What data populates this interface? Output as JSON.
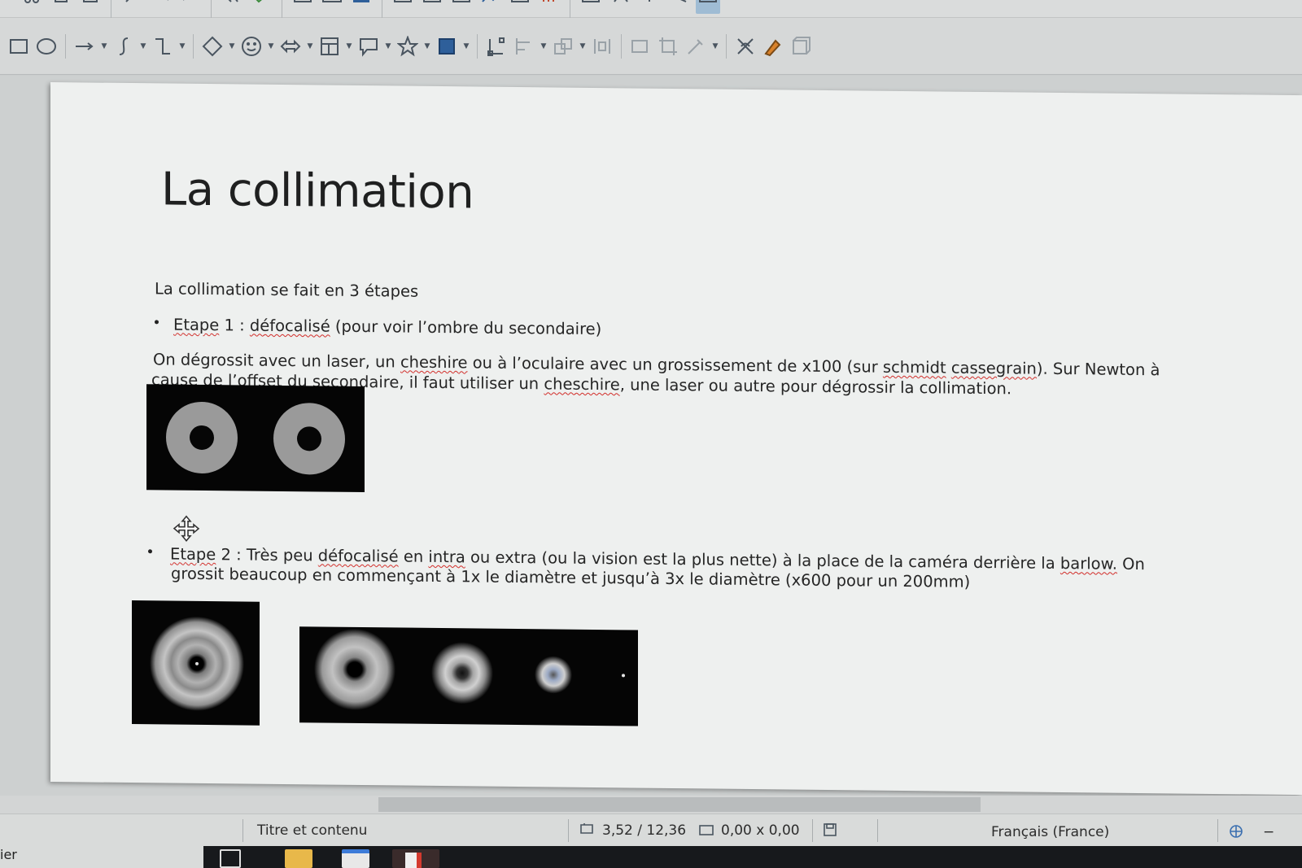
{
  "slide": {
    "title": "La collimation",
    "intro": "La collimation se fait en 3 étapes",
    "step1": {
      "label": "Etape",
      "num": " 1 : ",
      "word": "défocalisé",
      "rest": " (pour voir l’ombre du secondaire)"
    },
    "para1": {
      "a": "On dégrossit avec un laser, un ",
      "b": "cheshire",
      "c": " ou à l’oculaire avec un grossissement de x100 (sur ",
      "d": "schmidt",
      "e": " ",
      "f": "cassegrain",
      "g": "). Sur Newton à",
      "h": "cause de l’offset du secondaire, il faut utiliser un ",
      "i": "cheschire",
      "j": ", une laser ou autre pour dégrossir la collimation."
    },
    "step2": {
      "label": "Etape",
      "num": " 2 : Très peu ",
      "word": "défocalisé",
      "mid1": " en ",
      "intra": "intra",
      "mid2": " ou extra (ou la vision est la plus nette) à la place de la caméra derrière la ",
      "barlow": "barlow.",
      "end": " On",
      "line2": "grossit beaucoup en commençant à 1x le diamètre et jusqu’à 3x le diamètre (x600 pour un 200mm)"
    }
  },
  "statusbar": {
    "layout": "Titre et contenu",
    "position": "3,52 / 12,36",
    "size": "0,00 x 0,00",
    "language": "Français (France)",
    "left_fragment": "ier"
  },
  "icons": {
    "toolbar_draw": [
      "rectangle-icon",
      "ellipse-icon",
      "line-arrow-icon",
      "curve-icon",
      "connector-icon",
      "diamond-icon",
      "smiley-icon",
      "double-arrow-icon",
      "flowchart-icon",
      "callout-icon",
      "star-icon",
      "shadow-icon",
      "points-icon",
      "align-icon",
      "arrange-icon",
      "distribute-icon",
      "shadow-box-icon",
      "crop-icon",
      "eyedropper-icon",
      "glue-icon",
      "fontwork-icon",
      "extrusion-icon"
    ],
    "colors": {
      "accent": "#9fbcd4",
      "slide_bg": "#eef0ef",
      "image_bg": "#050505",
      "spell_underline": "#d2302c"
    }
  }
}
